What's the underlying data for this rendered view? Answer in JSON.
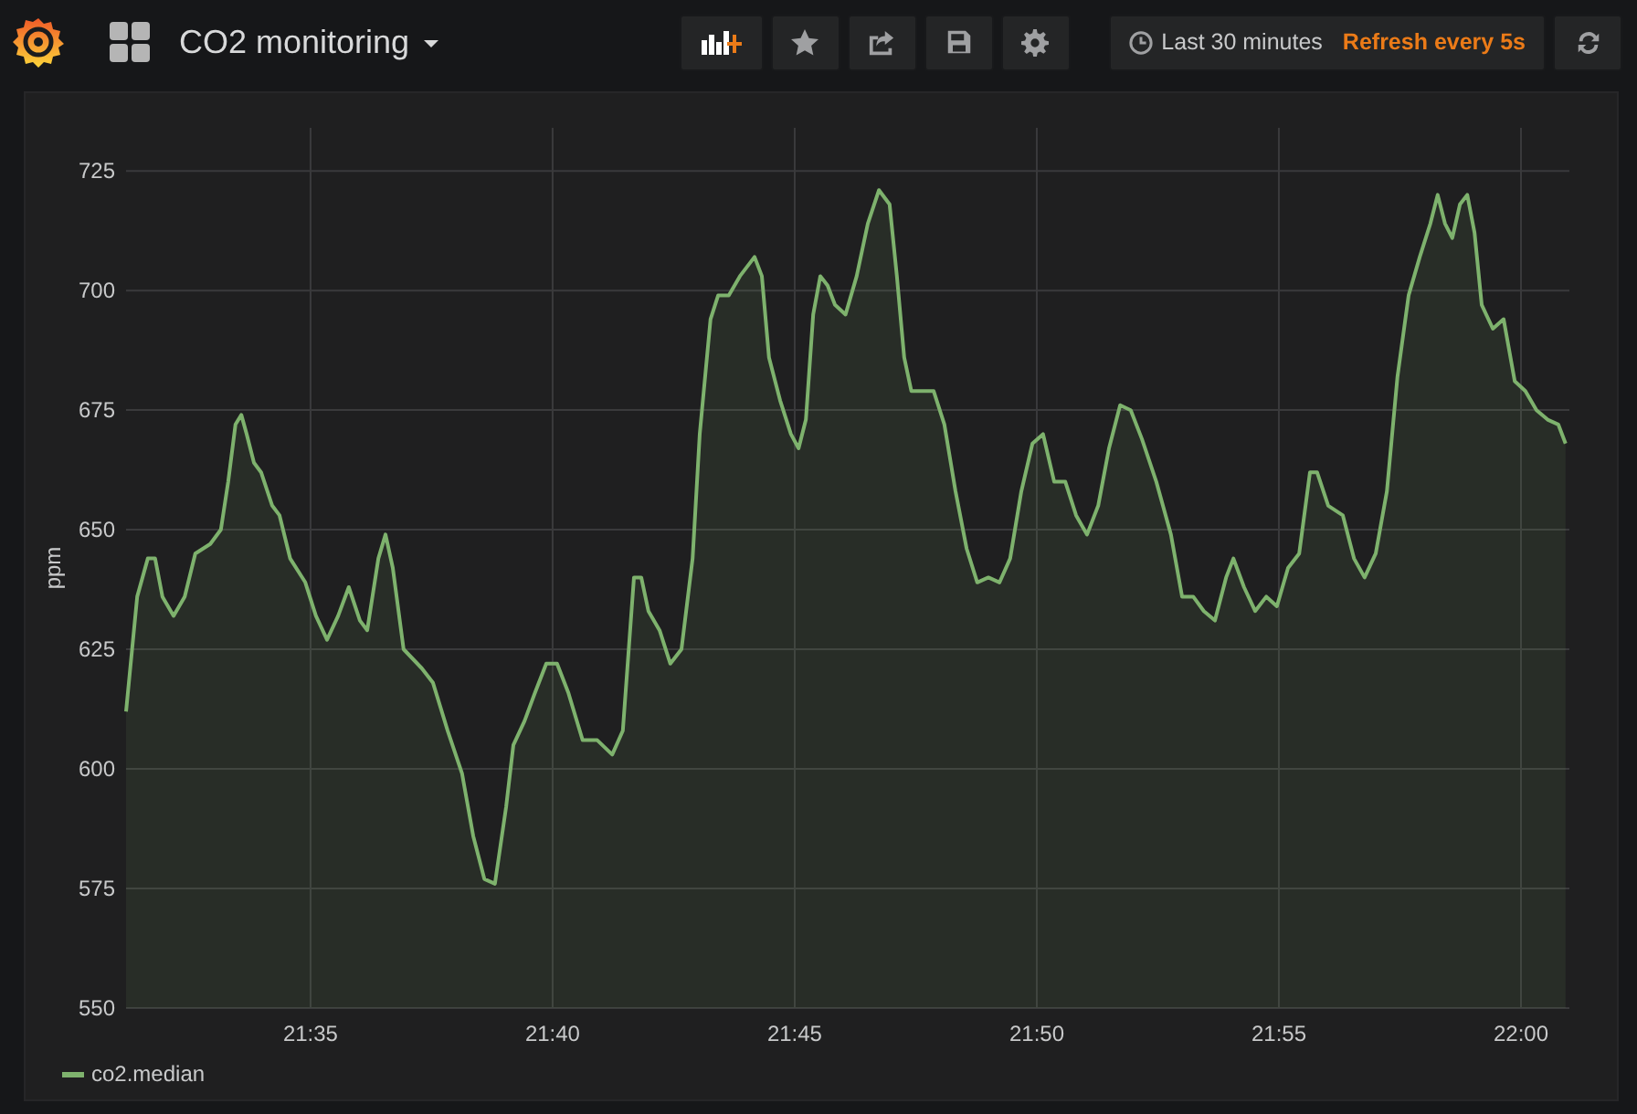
{
  "navbar": {
    "title": "CO2 monitoring"
  },
  "time_picker": {
    "range": "Last 30 minutes",
    "refresh": "Refresh every 5s"
  },
  "panel": {
    "chart_data": {
      "type": "area",
      "ylabel": "ppm",
      "grid": true,
      "xlim": [
        1291.19,
        1321.0
      ],
      "ylim": [
        550,
        734
      ],
      "yticks": [
        550,
        575,
        600,
        625,
        650,
        675,
        700,
        725
      ],
      "xticks": [
        {
          "value": 1295,
          "label": "21:35"
        },
        {
          "value": 1300,
          "label": "21:40"
        },
        {
          "value": 1305,
          "label": "21:45"
        },
        {
          "value": 1310,
          "label": "21:50"
        },
        {
          "value": 1315,
          "label": "21:55"
        },
        {
          "value": 1320,
          "label": "22:00"
        }
      ],
      "x": [
        1291.19,
        1291.42,
        1291.64,
        1291.79,
        1291.94,
        1292.17,
        1292.4,
        1292.62,
        1292.93,
        1293.15,
        1293.3,
        1293.45,
        1293.57,
        1293.68,
        1293.83,
        1293.98,
        1294.21,
        1294.36,
        1294.58,
        1294.89,
        1295.11,
        1295.34,
        1295.57,
        1295.79,
        1296.02,
        1296.17,
        1296.4,
        1296.55,
        1296.7,
        1296.92,
        1297.3,
        1297.53,
        1297.83,
        1298.13,
        1298.36,
        1298.59,
        1298.81,
        1299.04,
        1299.19,
        1299.42,
        1299.64,
        1299.87,
        1300.09,
        1300.32,
        1300.62,
        1300.92,
        1301.23,
        1301.45,
        1301.68,
        1301.83,
        1301.98,
        1302.21,
        1302.43,
        1302.66,
        1302.89,
        1303.04,
        1303.26,
        1303.42,
        1303.64,
        1303.87,
        1304.17,
        1304.32,
        1304.47,
        1304.7,
        1304.92,
        1305.08,
        1305.23,
        1305.38,
        1305.53,
        1305.68,
        1305.83,
        1306.05,
        1306.28,
        1306.51,
        1306.74,
        1306.96,
        1307.11,
        1307.26,
        1307.41,
        1307.64,
        1307.87,
        1308.09,
        1308.32,
        1308.55,
        1308.77,
        1309.0,
        1309.23,
        1309.45,
        1309.68,
        1309.91,
        1310.13,
        1310.36,
        1310.59,
        1310.81,
        1311.04,
        1311.27,
        1311.49,
        1311.72,
        1311.94,
        1312.17,
        1312.47,
        1312.77,
        1313.0,
        1313.23,
        1313.45,
        1313.68,
        1313.91,
        1314.06,
        1314.28,
        1314.51,
        1314.74,
        1314.96,
        1315.19,
        1315.42,
        1315.64,
        1315.79,
        1316.02,
        1316.32,
        1316.55,
        1316.77,
        1317.0,
        1317.23,
        1317.45,
        1317.68,
        1317.91,
        1318.13,
        1318.28,
        1318.43,
        1318.58,
        1318.74,
        1318.89,
        1319.04,
        1319.19,
        1319.42,
        1319.64,
        1319.87,
        1320.09,
        1320.32,
        1320.55,
        1320.77,
        1320.92
      ],
      "series": [
        {
          "name": "co2.median",
          "color": "#7eb26d",
          "values": [
            612,
            636,
            644,
            644,
            636,
            632,
            636,
            645,
            647,
            650,
            660,
            672,
            674,
            670,
            664,
            662,
            655,
            653,
            644,
            639,
            632,
            627,
            632,
            638,
            631,
            629,
            644,
            649,
            642,
            625,
            621,
            618,
            608,
            599,
            586,
            577,
            576,
            592,
            605,
            610,
            616,
            622,
            622,
            616,
            606,
            606,
            603,
            608,
            640,
            640,
            633,
            629,
            622,
            625,
            644,
            670,
            694,
            699,
            699,
            703,
            707,
            703,
            686,
            677,
            670,
            667,
            673,
            695,
            703,
            701,
            697,
            695,
            703,
            714,
            721,
            718,
            703,
            686,
            679,
            679,
            679,
            672,
            658,
            646,
            639,
            640,
            639,
            644,
            658,
            668,
            670,
            660,
            660,
            653,
            649,
            655,
            667,
            676,
            675,
            669,
            660,
            649,
            636,
            636,
            633,
            631,
            640,
            644,
            638,
            633,
            636,
            634,
            642,
            645,
            662,
            662,
            655,
            653,
            644,
            640,
            645,
            658,
            682,
            699,
            707,
            714,
            720,
            714,
            711,
            718,
            720,
            712,
            697,
            692,
            694,
            681,
            679,
            675,
            673,
            672,
            668
          ]
        }
      ]
    }
  }
}
